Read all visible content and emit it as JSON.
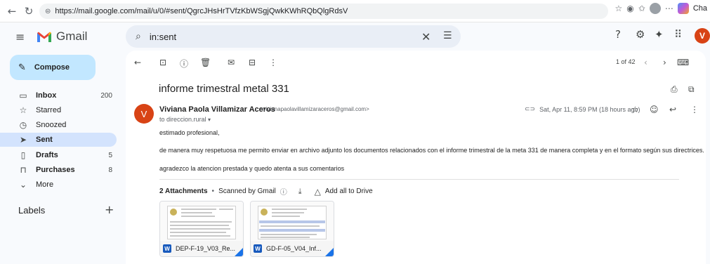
{
  "browser": {
    "url": "https://mail.google.com/mail/u/0/#sent/QgrcJHsHrTVfzKbWSgjQwkKWhRQbQlgRdsV",
    "profile_label": "Cha"
  },
  "app": {
    "name": "Gmail"
  },
  "search": {
    "query": "in:sent"
  },
  "compose": {
    "label": "Compose"
  },
  "sidebar": {
    "items": [
      {
        "label": "Inbox",
        "count": "200",
        "icon": "inbox-icon",
        "active": false
      },
      {
        "label": "Starred",
        "count": "",
        "icon": "star-icon",
        "active": false
      },
      {
        "label": "Snoozed",
        "count": "",
        "icon": "clock-icon",
        "active": false
      },
      {
        "label": "Sent",
        "count": "",
        "icon": "send-icon",
        "active": true
      },
      {
        "label": "Drafts",
        "count": "5",
        "icon": "draft-icon",
        "active": false
      },
      {
        "label": "Purchases",
        "count": "8",
        "icon": "bag-icon",
        "active": false
      },
      {
        "label": "More",
        "count": "",
        "icon": "chevron-down-icon",
        "active": false
      }
    ],
    "labels_title": "Labels"
  },
  "user": {
    "initial": "V"
  },
  "toolbar": {
    "pager": "1 of 42"
  },
  "email": {
    "subject": "informe trimestral metal 331",
    "sender_name": "Viviana Paola Villamizar Aceros",
    "sender_email": "<vivianapaolavillamizaraceros@gmail.com>",
    "to": "to direccion.rural",
    "date": "Sat, Apr 11, 8:59 PM (18 hours ago)",
    "sender_initial": "V",
    "body": [
      "estimado profesional,",
      "de manera muy respetuosa me permito enviar en archivo adjunto los documentos relacionados con el informe trimestral de la meta 331 de manera completa y en el formato según sus directrices.",
      "agradezco la atencion prestada y quedo atenta a sus comentarios"
    ]
  },
  "attachments": {
    "header": "2 Attachments",
    "scanned": "Scanned by Gmail",
    "add_all": "Add all to Drive",
    "files": [
      {
        "name": "DEP-F-19_V03_Re..."
      },
      {
        "name": "GD-F-05_V04_Inf..."
      }
    ]
  },
  "colors": {
    "accent": "#c2e7ff",
    "active_nav": "#d3e3fd",
    "avatar": "#d84315",
    "word_blue": "#185abd"
  }
}
